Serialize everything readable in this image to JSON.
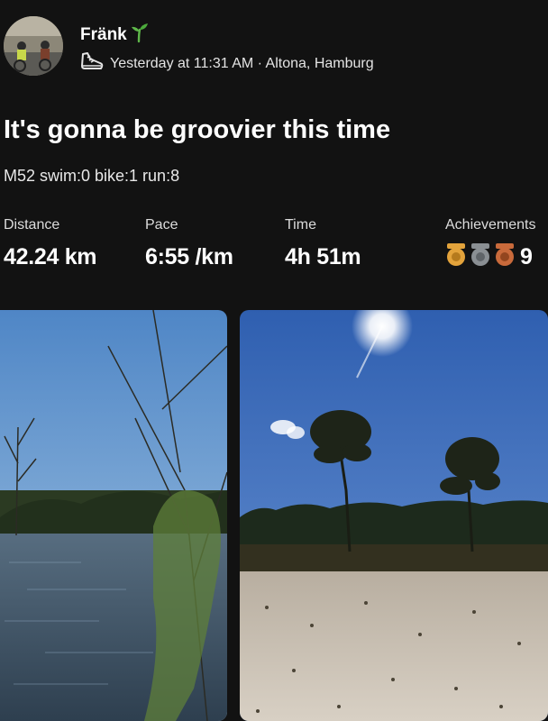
{
  "header": {
    "user_name": "Fränk",
    "name_emoji_icon": "seedling-icon",
    "activity_icon": "running-shoe-icon",
    "meta": "Yesterday at 11:31 AM · Altona, Hamburg"
  },
  "activity": {
    "title": "It's gonna be groovier this time",
    "description": "M52 swim:0 bike:1 run:8"
  },
  "stats": {
    "distance": {
      "label": "Distance",
      "value": "42.24 km"
    },
    "pace": {
      "label": "Pace",
      "value": "6:55 /km"
    },
    "time": {
      "label": "Time",
      "value": "4h 51m"
    },
    "achievements": {
      "label": "Achievements",
      "count": "9",
      "icons": [
        "gold-medal-icon",
        "silver-medal-icon",
        "bronze-medal-icon"
      ]
    }
  },
  "photos": [
    {
      "name": "lake-photo"
    },
    {
      "name": "pine-trees-sand-photo"
    }
  ],
  "colors": {
    "background": "#121212",
    "gold": "#e3a33b",
    "silver": "#8a8f93",
    "bronze": "#c96a3b"
  }
}
